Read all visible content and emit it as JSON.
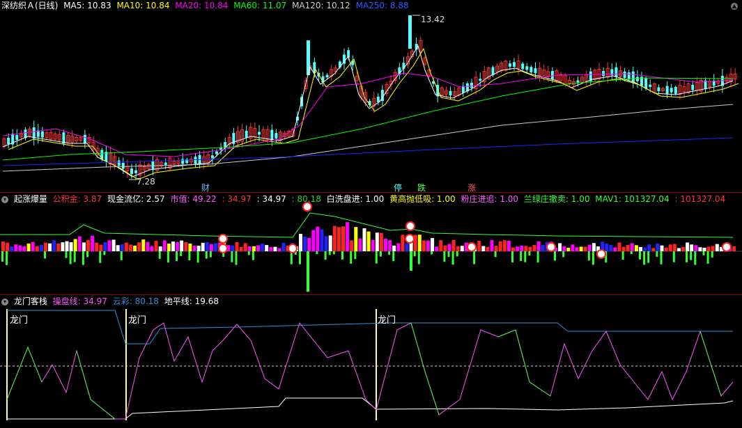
{
  "panel_main": {
    "title": "深纺织Ａ(日线)",
    "ma": [
      {
        "label": "MA5: 10.83",
        "color": "#ffffff"
      },
      {
        "label": "MA10: 10.84",
        "color": "#ffff00"
      },
      {
        "label": "MA20: 10.84",
        "color": "#ff00ff"
      },
      {
        "label": "MA60: 11.07",
        "color": "#00ff00"
      },
      {
        "label": "MA120: 10.12",
        "color": "#cccccc"
      },
      {
        "label": "MA250: 8.88",
        "color": "#3333ff"
      }
    ],
    "high_label": "13.42",
    "low_label": "7.28",
    "event_tags": [
      {
        "text": "财",
        "color": "#6ab7ff"
      },
      {
        "text": "停",
        "color": "#55ffff"
      },
      {
        "text": "跌",
        "color": "#55ff55"
      },
      {
        "text": "涨",
        "color": "#ff5555"
      }
    ]
  },
  "panel_mid": {
    "title": "起涨爆量",
    "fields": [
      {
        "label": "公积金: 3.87",
        "color": "#ff3333"
      },
      {
        "label": "现金流亿: 2.57",
        "color": "#ffffff"
      },
      {
        "label": "市值: 49.22",
        "color": "#ff55ff"
      },
      {
        "label": ": 34.97",
        "color": "#ff3333"
      },
      {
        "label": ": 34.97",
        "color": "#ffffff"
      },
      {
        "label": ": 80.18",
        "color": "#33cc33"
      },
      {
        "label": "白洗盘进: 1.00",
        "color": "#ffffff"
      },
      {
        "label": "黄高抛低吸: 1.00",
        "color": "#ffff00"
      },
      {
        "label": "粉庄进追: 1.00",
        "color": "#ff55ff"
      },
      {
        "label": "兰绿庄撤卖: 1.00",
        "color": "#33ff33"
      },
      {
        "label": "MAV1: 101327.04",
        "color": "#33ff33"
      },
      {
        "label": ": 101327.04",
        "color": "#ff3333"
      }
    ]
  },
  "panel_bottom": {
    "title": "龙门客栈",
    "fields": [
      {
        "label": "操盘线: 34.97",
        "color": "#ff55ff"
      },
      {
        "label": "云彩: 80.18",
        "color": "#2a8fd8"
      },
      {
        "label": "地平线: 19.68",
        "color": "#ffffff"
      }
    ],
    "markers": [
      "龙门",
      "龙门",
      "龙门"
    ]
  }
}
